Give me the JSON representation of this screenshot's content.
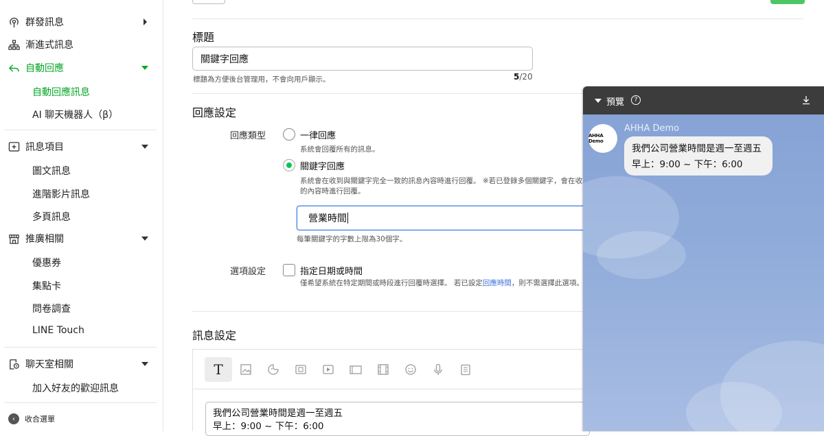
{
  "sidebar": {
    "groups": [
      {
        "label": "群發訊息",
        "icon": "broadcast-icon"
      },
      {
        "label": "漸進式訊息",
        "icon": "step-flow-icon"
      },
      {
        "label": "自動回應",
        "icon": "reply-icon"
      },
      {
        "label": "訊息項目",
        "icon": "add-box-icon"
      },
      {
        "label": "推廣相關",
        "icon": "store-icon"
      },
      {
        "label": "聊天室相關",
        "icon": "chat-settings-icon"
      }
    ],
    "auto_reply_subitems": [
      "自動回應訊息",
      "AI 聊天機器人（β）"
    ],
    "message_subitems": [
      "圖文訊息",
      "進階影片訊息",
      "多頁訊息"
    ],
    "promo_subitems": [
      "優惠券",
      "集點卡",
      "問卷調查",
      "LINE Touch"
    ],
    "chat_subitems": [
      "加入好友的歡迎訊息"
    ],
    "collapse_label": "收合選單"
  },
  "title_section": {
    "heading": "標題",
    "value": "關鍵字回應",
    "hint": "標題為方便後台管理用，不會向用戶顯示。",
    "count_current": "5",
    "count_max": "/20"
  },
  "response_section": {
    "heading": "回應設定",
    "type_label": "回應類型",
    "option_all_label": "一律回應",
    "option_all_desc": "系統會回覆所有的訊息。",
    "option_keyword_label": "關鍵字回應",
    "option_keyword_desc_1": "系統會在收到與關鍵字完全一致的訊息內容時進行回覆。 ※若已登錄多個關鍵字，會在收到",
    "option_keyword_desc_2": "的內容時進行回覆。",
    "keyword_value": "營業時間",
    "keyword_hint": "每筆關鍵字的字數上限為30個字。",
    "option_settings_label": "選項設定",
    "date_option_label": "指定日期或時間",
    "date_option_desc_pre": "僅希望系統在特定期間或時段進行回覆時選擇。 若已設定",
    "date_option_link": "回應時間",
    "date_option_desc_post": "，則不需選擇此選項。"
  },
  "message_section": {
    "heading": "訊息設定",
    "toolbar_icons": [
      "text-icon",
      "image-icon",
      "sticker-icon",
      "coupon-icon",
      "video-icon",
      "card-icon",
      "rich-video-icon",
      "emoji-icon",
      "voice-icon",
      "survey-icon"
    ],
    "toolbar_text_glyph": "T",
    "body_line1": "我們公司營業時間是週一至週五",
    "body_line2": "早上：9:00 ~ 下午：6:00"
  },
  "preview": {
    "title": "預覽",
    "account_name": "AHHA Demo",
    "avatar_text": "AHHA Demo",
    "bubble_line1": "我們公司營業時間是週一至週五",
    "bubble_line2": "早上：9:00 ~ 下午：6:00"
  },
  "colors": {
    "accent_green": "#06a628",
    "link_blue": "#3a73d9",
    "preview_bg": "#8fabd9",
    "preview_header": "#3c3c3c"
  }
}
